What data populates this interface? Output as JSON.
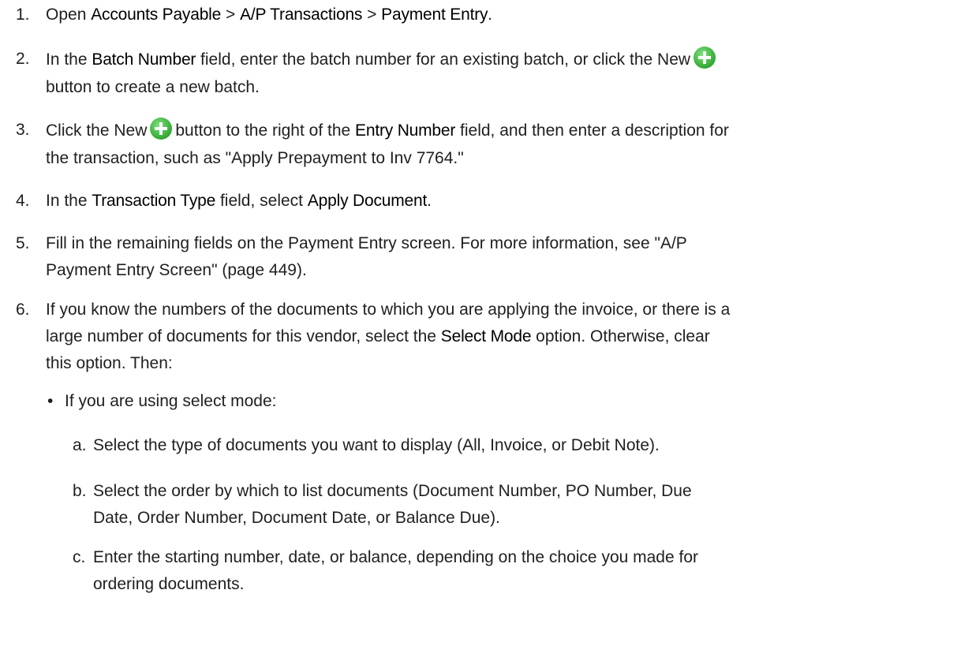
{
  "steps": [
    {
      "number": "1.",
      "parts": [
        "Open ",
        "Accounts Payable",
        " > ",
        "A/P Transactions",
        " > ",
        "Payment Entry",
        "."
      ]
    },
    {
      "number": "2.",
      "parts": [
        "In the ",
        "Batch Number",
        " field, enter the batch number for an existing batch, or click the New",
        "button to create a new batch."
      ]
    },
    {
      "number": "3.",
      "parts": [
        "Click the New",
        "button to the right of the ",
        "Entry Number",
        " field, and then enter a description for",
        "the transaction, such as \"Apply Prepayment to Inv 7764.\""
      ]
    },
    {
      "number": "4.",
      "parts": [
        "In the ",
        "Transaction Type",
        " field, select ",
        "Apply Document",
        "."
      ]
    },
    {
      "number": "5.",
      "parts": [
        "Fill in the remaining fields on the Payment Entry screen. For more information, see \"A/P",
        "Payment Entry Screen\" (page 449)."
      ]
    },
    {
      "number": "6.",
      "parts": [
        "If you know the numbers of the documents to which you are applying the invoice, or there is a",
        "large number of documents for this vendor, select the ",
        "Select Mode",
        " option. Otherwise, clear",
        "this option. Then:"
      ]
    }
  ],
  "bullet": {
    "symbol": "•",
    "text": "If you are using select mode:"
  },
  "substeps": [
    {
      "letter": "a.",
      "lines": [
        "Select the type of documents you want to display (All, Invoice, or Debit Note)."
      ]
    },
    {
      "letter": "b.",
      "lines": [
        "Select the order by which to list documents (Document Number, PO Number, Due",
        "Date, Order Number, Document Date, or Balance Due)."
      ]
    },
    {
      "letter": "c.",
      "lines": [
        "Enter the starting number, date, or balance, depending on the choice you made for",
        "ordering documents."
      ]
    }
  ],
  "icons": {
    "new_button_icon": "plus-circle-icon",
    "new_button_color": "#3cb83c"
  }
}
